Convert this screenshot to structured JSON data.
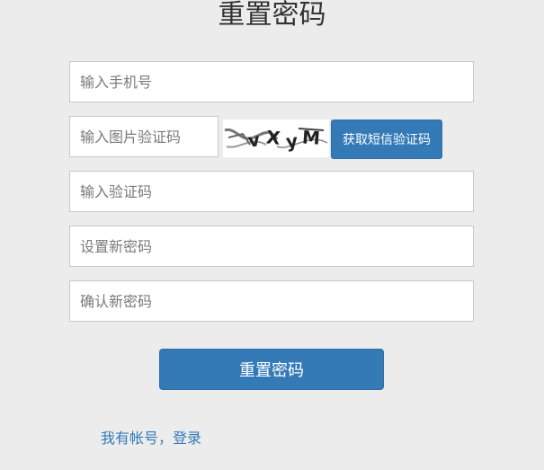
{
  "page": {
    "title": "重置密码"
  },
  "form": {
    "phone_placeholder": "输入手机号",
    "image_code_placeholder": "输入图片验证码",
    "captcha_text": "vXyM",
    "sms_button_label": "获取短信验证码",
    "sms_code_placeholder": "输入验证码",
    "new_password_placeholder": "设置新密码",
    "confirm_password_placeholder": "确认新密码",
    "submit_label": "重置密码"
  },
  "footer": {
    "login_link": "我有帐号，登录"
  },
  "colors": {
    "primary": "#337ab7",
    "background": "#ececec"
  }
}
